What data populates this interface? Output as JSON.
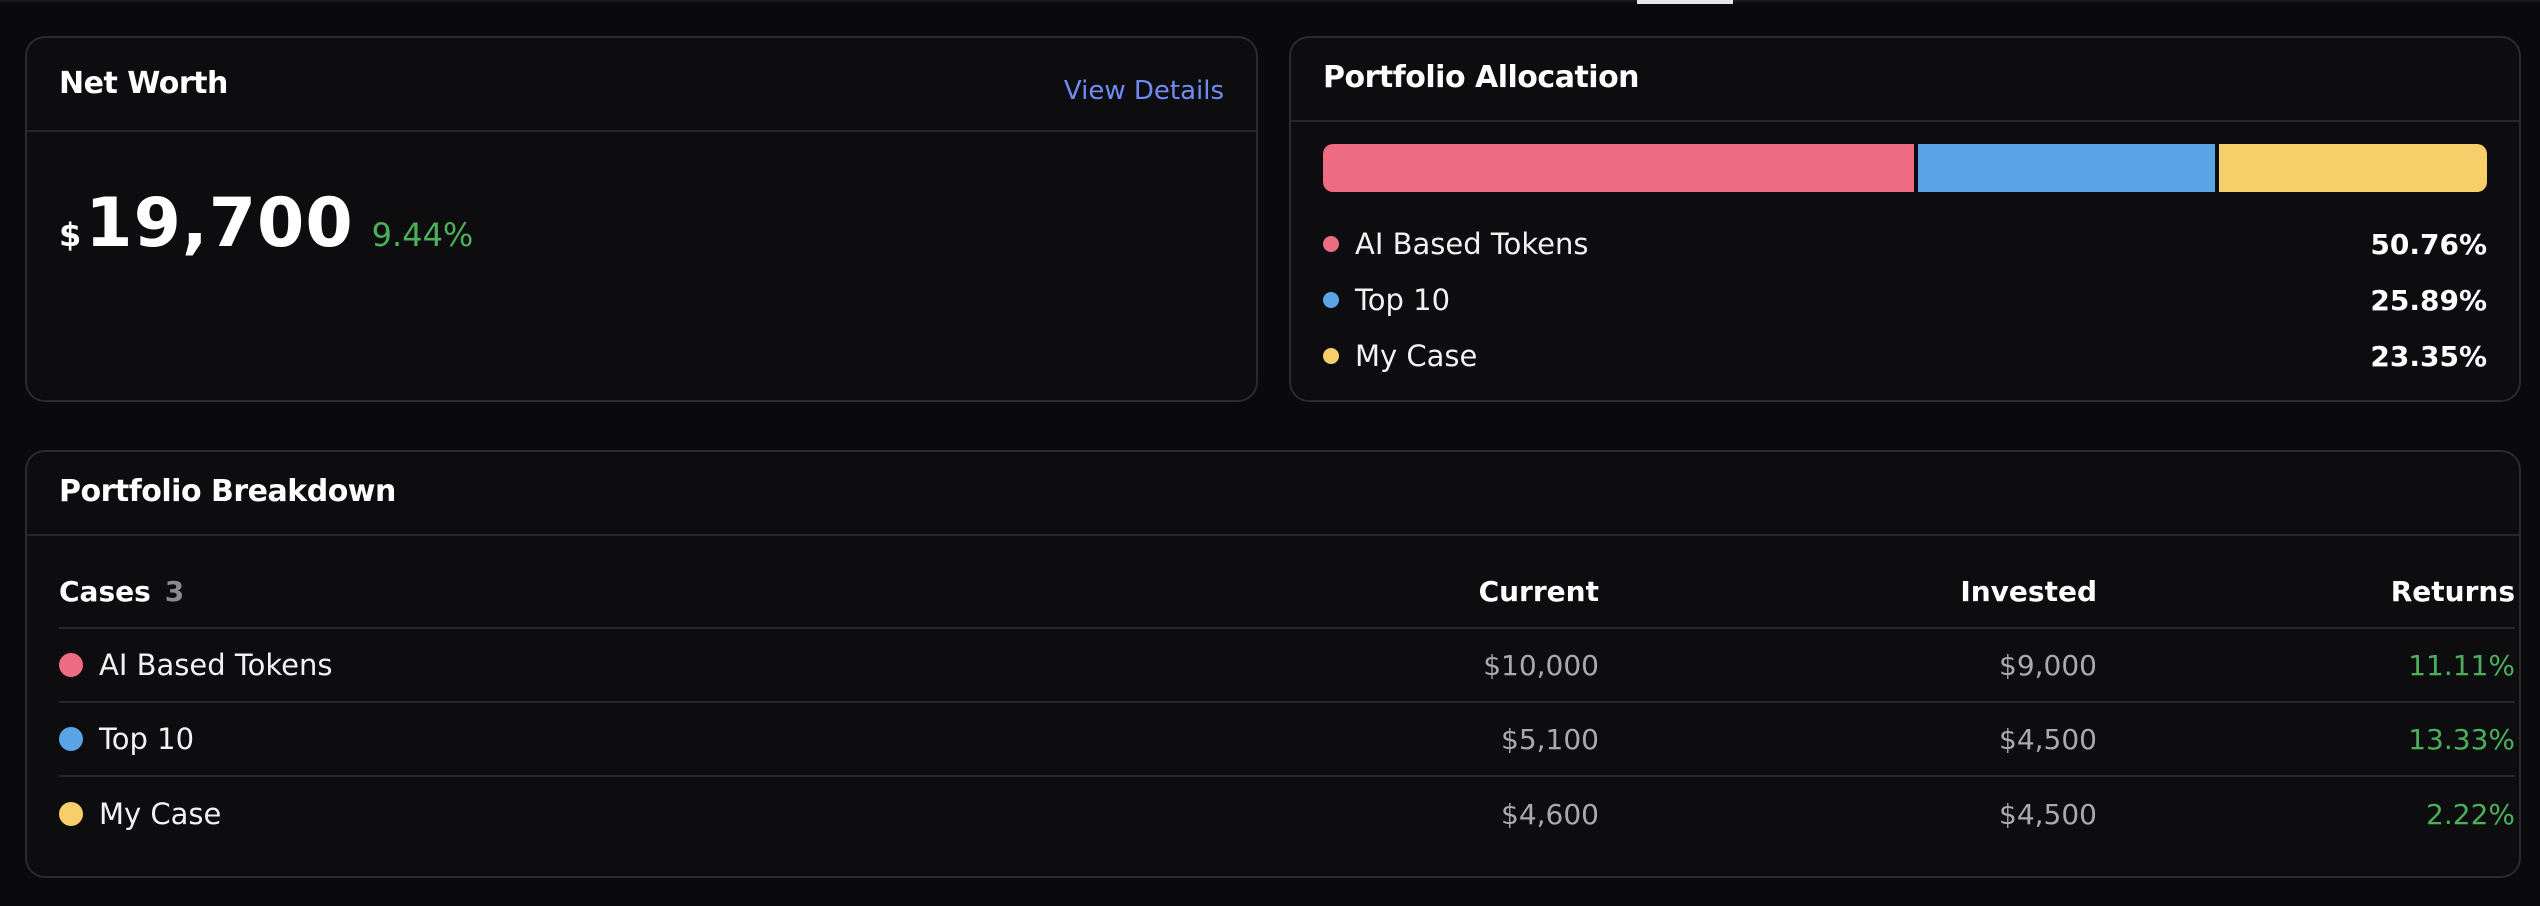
{
  "net_worth": {
    "title": "Net Worth",
    "view_details_label": "View Details",
    "currency_symbol": "$",
    "amount": "19,700",
    "change": "9.44%",
    "change_color": "#4caf5a"
  },
  "allocation": {
    "title": "Portfolio Allocation",
    "items": [
      {
        "name": "AI Based Tokens",
        "percent_label": "50.76%",
        "percent": 50.76,
        "color": "#ee6b84"
      },
      {
        "name": "Top 10",
        "percent_label": "25.89%",
        "percent": 25.89,
        "color": "#5aa4e6"
      },
      {
        "name": "My Case",
        "percent_label": "23.35%",
        "percent": 23.35,
        "color": "#f6cf6a"
      }
    ]
  },
  "breakdown": {
    "title": "Portfolio Breakdown",
    "columns": {
      "cases": "Cases",
      "cases_count": "3",
      "current": "Current",
      "invested": "Invested",
      "returns": "Returns"
    },
    "rows": [
      {
        "name": "AI Based Tokens",
        "current": "$10,000",
        "invested": "$9,000",
        "returns": "11.11%",
        "color": "#ee6b84"
      },
      {
        "name": "Top 10",
        "current": "$5,100",
        "invested": "$4,500",
        "returns": "13.33%",
        "color": "#5aa4e6"
      },
      {
        "name": "My Case",
        "current": "$4,600",
        "invested": "$4,500",
        "returns": "2.22%",
        "color": "#f6cf6a"
      }
    ]
  }
}
